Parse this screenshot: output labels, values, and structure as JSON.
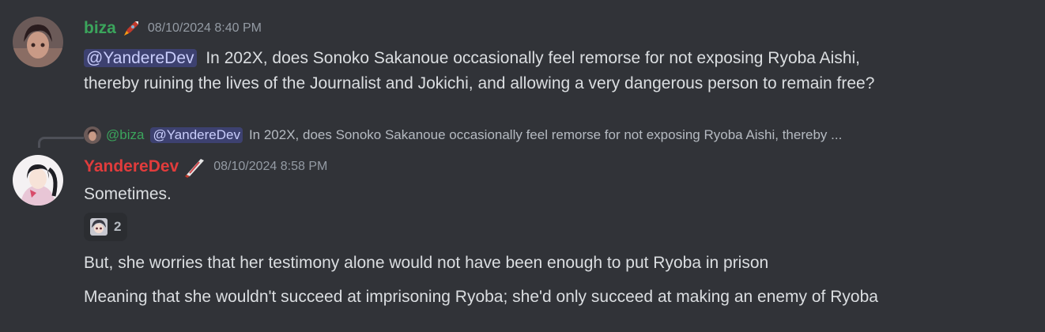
{
  "messages": [
    {
      "username": "biza",
      "username_color": "#3ba55c",
      "role_icon": "rocket-icon",
      "timestamp": "08/10/2024 8:40 PM",
      "mention": "@YandereDev",
      "text_line1": "In 202X, does Sonoko Sakanoue occasionally feel remorse for not exposing Ryoba Aishi,",
      "text_line2": "thereby ruining the lives of the Journalist and Jokichi, and allowing a very dangerous person to remain free?"
    },
    {
      "reply": {
        "username": "@biza",
        "username_color": "#3ba55c",
        "mention": "@YandereDev",
        "snippet": "In 202X, does Sonoko Sakanoue occasionally feel remorse for not exposing Ryoba Aishi, thereby ..."
      },
      "username": "YandereDev",
      "username_color": "#e13c3c",
      "role_icon": "knife-icon",
      "timestamp": "08/10/2024 8:58 PM",
      "text": "Sometimes.",
      "reaction": {
        "emoji": "anime-face-emoji",
        "count": "2"
      },
      "followups": [
        "But, she worries that her testimony alone would not have been enough to put Ryoba in prison",
        "Meaning that she wouldn't succeed at imprisoning Ryoba; she'd only succeed at making an enemy of Ryoba"
      ]
    }
  ]
}
